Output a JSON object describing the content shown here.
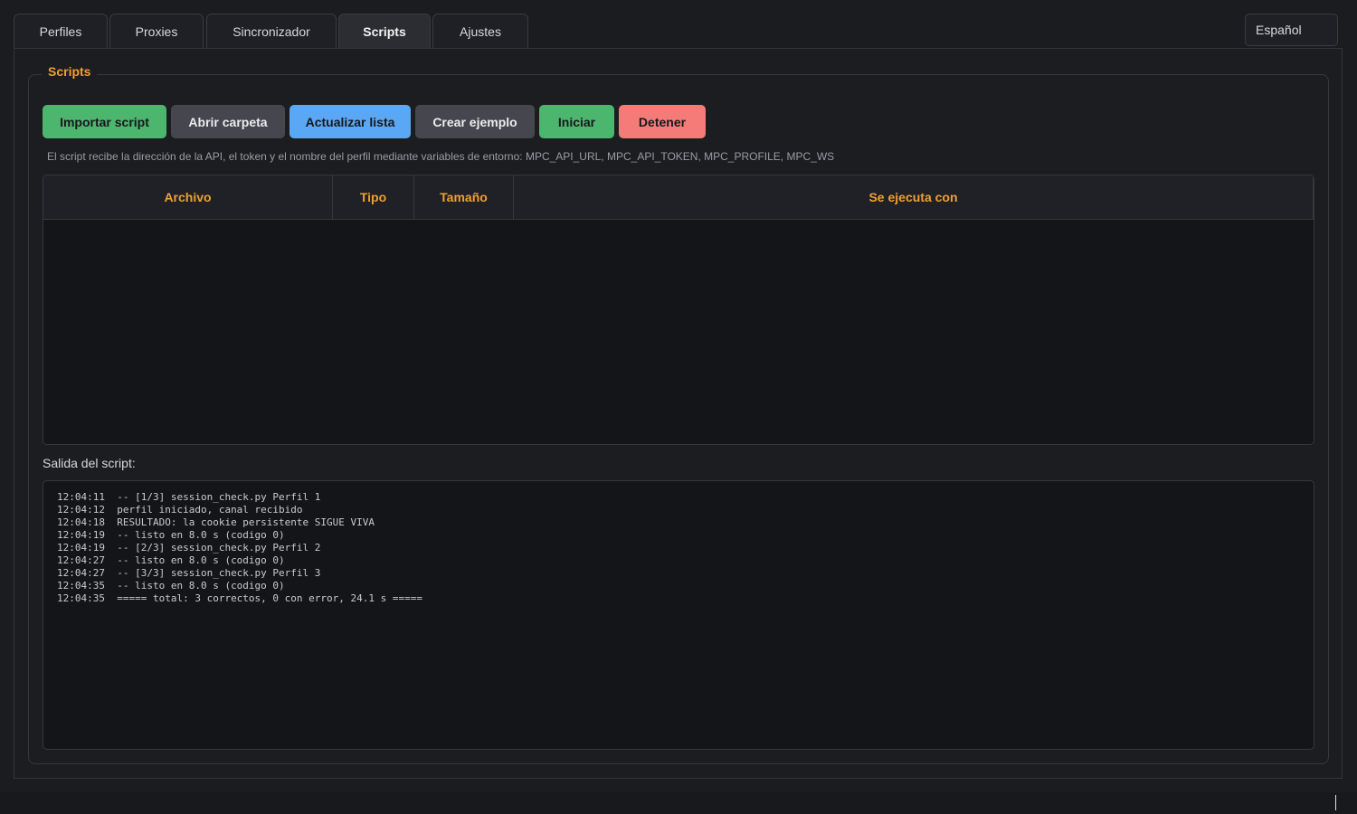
{
  "tabs": [
    {
      "label": "Perfiles",
      "active": false
    },
    {
      "label": "Proxies",
      "active": false
    },
    {
      "label": "Sincronizador",
      "active": false
    },
    {
      "label": "Scripts",
      "active": true
    },
    {
      "label": "Ajustes",
      "active": false
    }
  ],
  "language": {
    "selected": "Español"
  },
  "scripts_group": {
    "title": "Scripts",
    "buttons": {
      "import": "Importar script",
      "open_folder": "Abrir carpeta",
      "refresh": "Actualizar lista",
      "create_example": "Crear ejemplo",
      "start": "Iniciar",
      "stop": "Detener"
    },
    "hint": "El script recibe la dirección de la API, el token y el nombre del perfil mediante variables de entorno: MPC_API_URL, MPC_API_TOKEN, MPC_PROFILE, MPC_WS",
    "table": {
      "columns": [
        "Archivo",
        "Tipo",
        "Tamaño",
        "Se ejecuta con"
      ],
      "rows": []
    },
    "output_label": "Salida del script:",
    "output": [
      {
        "time": "12:04:11",
        "text": "-- [1/3] session_check.py Perfil 1"
      },
      {
        "time": "12:04:12",
        "text": "perfil iniciado, canal recibido"
      },
      {
        "time": "12:04:18",
        "text": "RESULTADO: la cookie persistente SIGUE VIVA"
      },
      {
        "time": "12:04:19",
        "text": "-- listo en 8.0 s (codigo 0)"
      },
      {
        "time": "12:04:19",
        "text": "-- [2/3] session_check.py Perfil 2"
      },
      {
        "time": "12:04:27",
        "text": "-- listo en 8.0 s (codigo 0)"
      },
      {
        "time": "12:04:27",
        "text": "-- [3/3] session_check.py Perfil 3"
      },
      {
        "time": "12:04:35",
        "text": "-- listo en 8.0 s (codigo 0)"
      },
      {
        "time": "12:04:35",
        "text": "===== total: 3 correctos, 0 con error, 24.1 s ====="
      }
    ]
  },
  "colors": {
    "accent": "#f0a030",
    "green": "#4cb56e",
    "blue": "#5aa7f5",
    "red": "#f47b78",
    "gray_button": "#45464e",
    "background": "#1b1c20"
  }
}
